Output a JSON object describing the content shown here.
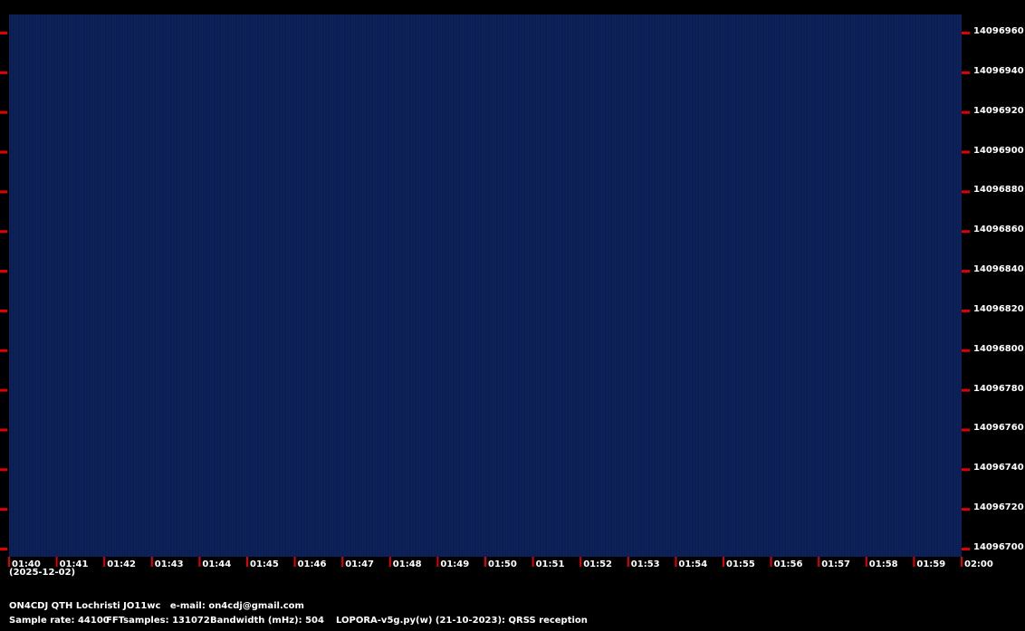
{
  "chart_data": {
    "type": "heatmap",
    "x_ticks": [
      "01:40",
      "01:41",
      "01:42",
      "01:43",
      "01:44",
      "01:45",
      "01:46",
      "01:47",
      "01:48",
      "01:49",
      "01:50",
      "01:51",
      "01:52",
      "01:53",
      "01:54",
      "01:55",
      "01:56",
      "01:57",
      "01:58",
      "01:59",
      "02:00"
    ],
    "date_label": "(2025-12-02)",
    "y_ticks": [
      "14096960",
      "14096940",
      "14096920",
      "14096900",
      "14096880",
      "14096860",
      "14096840",
      "14096820",
      "14096800",
      "14096780",
      "14096760",
      "14096740",
      "14096720",
      "14096700"
    ],
    "ylim": [
      14096700,
      14096960
    ],
    "background_color": "#0b2057",
    "tick_color": "#e00000",
    "signals": []
  },
  "footer": {
    "station": "ON4CDJ QTH Lochristi JO11wc   e-mail: on4cdj@gmail.com",
    "sample_rate": "Sample rate: 44100",
    "fft_samples": "FFTsamples: 131072",
    "bandwidth": "Bandwidth (mHz): 504",
    "software": "LOPORA-v5g.py(w) (21-10-2023): QRSS reception"
  }
}
